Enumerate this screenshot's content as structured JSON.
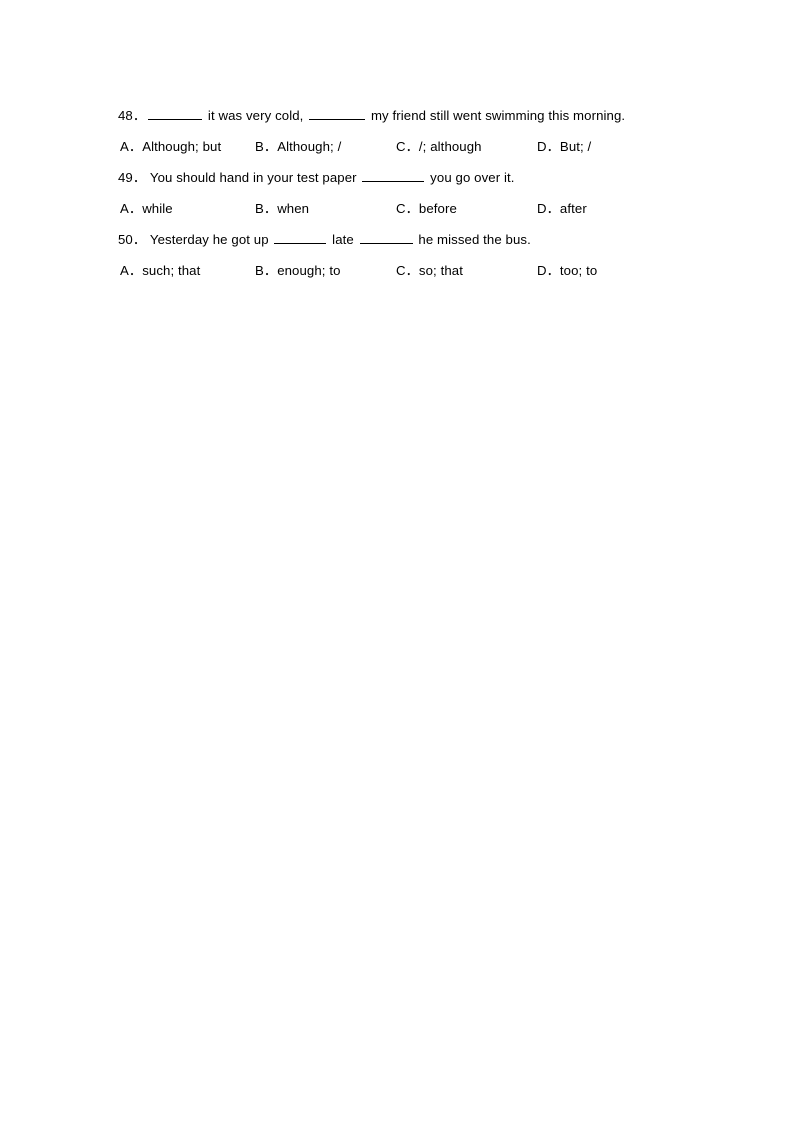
{
  "document": {
    "page_background": "#ffffff",
    "text_color": "#000000",
    "questions": [
      {
        "number": "48．",
        "stem_parts": [
          {
            "type": "blank"
          },
          {
            "type": "text",
            "value": " it was very cold, "
          },
          {
            "type": "blank"
          },
          {
            "type": "text",
            "value": " my friend still went swimming this morning."
          }
        ],
        "stem_plain": "48． ________ it was very cold, ________ my friend still went swimming this morning.",
        "options": [
          {
            "letter": "A．",
            "text": "Although; but"
          },
          {
            "letter": "B．",
            "text": "Although; /"
          },
          {
            "letter": "C．",
            "text": "/; although"
          },
          {
            "letter": "D．",
            "text": "But; /"
          }
        ]
      },
      {
        "number": "49．",
        "stem_parts": [
          {
            "type": "text",
            "value": "You should hand in your test paper "
          },
          {
            "type": "blank"
          },
          {
            "type": "text",
            "value": " you go over it."
          }
        ],
        "stem_plain": "49． You should hand in your test paper _________ you go over it.",
        "options": [
          {
            "letter": "A．",
            "text": "while"
          },
          {
            "letter": "B．",
            "text": "when"
          },
          {
            "letter": "C．",
            "text": "before"
          },
          {
            "letter": "D．",
            "text": "after"
          }
        ]
      },
      {
        "number": "50．",
        "stem_parts": [
          {
            "type": "text",
            "value": "Yesterday he got up "
          },
          {
            "type": "blank"
          },
          {
            "type": "text",
            "value": " late "
          },
          {
            "type": "blank"
          },
          {
            "type": "text",
            "value": " he missed the bus."
          }
        ],
        "stem_plain": "50． Yesterday he got up ________ late ________ he missed the bus.",
        "options": [
          {
            "letter": "A．",
            "text": "such; that"
          },
          {
            "letter": "B．",
            "text": "enough; to"
          },
          {
            "letter": "C．",
            "text": "so; that"
          },
          {
            "letter": "D．",
            "text": "too; to"
          }
        ]
      }
    ]
  }
}
